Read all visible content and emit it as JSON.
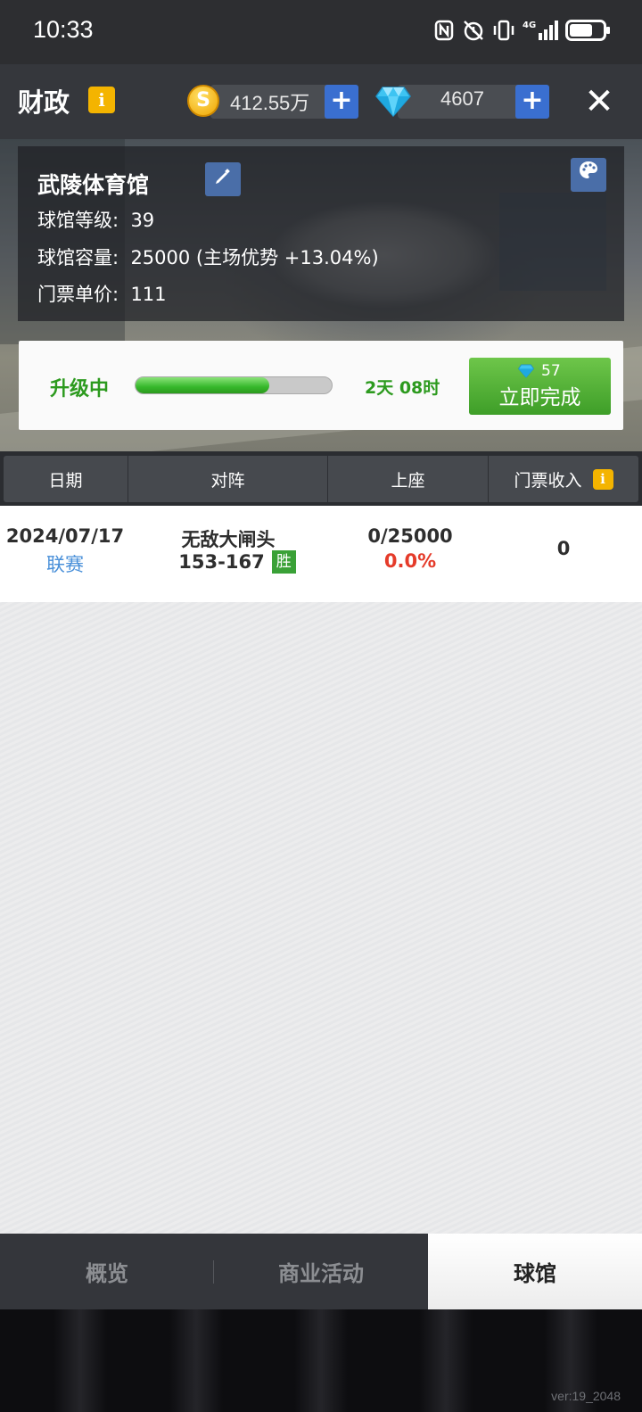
{
  "status_bar": {
    "time": "10:33",
    "network": "4G",
    "battery_level": 0.65
  },
  "header": {
    "title": "财政",
    "info_icon": "i",
    "coins": "412.55万",
    "gems": "4607",
    "coin_icon": "S",
    "plus_label": "+",
    "close_label": "✕"
  },
  "stadium": {
    "name": "武陵体育馆",
    "level_label": "球馆等级:",
    "level": "39",
    "capacity_label": "球馆容量:",
    "capacity": "25000 (主场优势 +13.04%)",
    "price_label": "门票单价:",
    "price": "111"
  },
  "upgrade": {
    "label": "升级中",
    "progress": 0.68,
    "time_left": "2天 08时",
    "finish_cost": "57",
    "finish_label": "立即完成"
  },
  "table": {
    "headers": [
      "日期",
      "对阵",
      "上座",
      "门票收入"
    ],
    "rows": [
      {
        "date": "2024/07/17",
        "type": "联赛",
        "opponent": "无敌大闸头",
        "score": "153-167",
        "result": "胜",
        "attendance": "0/25000",
        "rate": "0.0%",
        "income": "0"
      }
    ]
  },
  "tabs": [
    "概览",
    "商业活动",
    "球馆"
  ],
  "active_tab": "球馆",
  "version": "ver:19_2048",
  "colors": {
    "accent_green": "#2c9a1e",
    "rate_red": "#e53b2a",
    "link_blue": "#4a90d9",
    "info_yellow": "#f4b400"
  }
}
